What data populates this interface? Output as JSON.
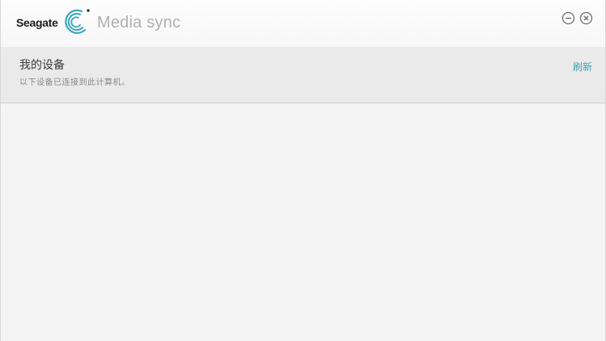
{
  "titlebar": {
    "brand": "Seagate",
    "app_title": "Media sync",
    "icons": {
      "logo": "seagate-logo-icon",
      "minimize": "minimize-icon",
      "close": "close-icon"
    }
  },
  "devices": {
    "title": "我的设备",
    "subtitle": "以下设备已连接到此计算机。",
    "refresh_label": "刷新"
  },
  "colors": {
    "accent": "#3fa0b2",
    "background": "#f4f4f4",
    "header_band": "#eaeaea"
  }
}
